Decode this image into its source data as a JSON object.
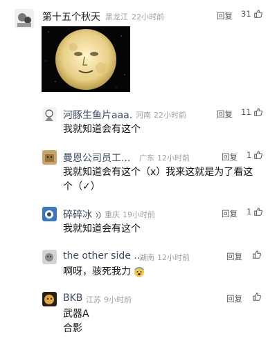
{
  "reply_label": "回复",
  "comments": [
    {
      "name": "第十五个秋天",
      "region": "黑龙江",
      "time": "22小时前",
      "likes": "31"
    },
    {
      "name": "河豚生鱼片aaa.",
      "region": "河南",
      "time": "22小时前",
      "likes": "11",
      "text": "我就知道会有这个"
    },
    {
      "name": "曼恩公司员工...",
      "region": "广东",
      "time": "12小时前",
      "likes": "1",
      "text_line1": "我就知道会有这个（x）我来这就是为了看这",
      "text_line2": "个（✓）"
    },
    {
      "name": "碎碎冰",
      "region": "重庆",
      "time": "19小时前",
      "likes": "1",
      "text": "我就知道会有这个"
    },
    {
      "name": "the other side ...",
      "region": "湖南",
      "time": "12小时前",
      "likes": "",
      "text": "啊呀，骇死我力"
    },
    {
      "name": "BKB",
      "region": "江苏",
      "time": "9小时前",
      "likes": "",
      "text_line1": "武器A",
      "text_line2": "合影"
    }
  ],
  "colors": {
    "username": "#3b4a63",
    "meta": "#a0a0a0",
    "text": "#111111"
  }
}
